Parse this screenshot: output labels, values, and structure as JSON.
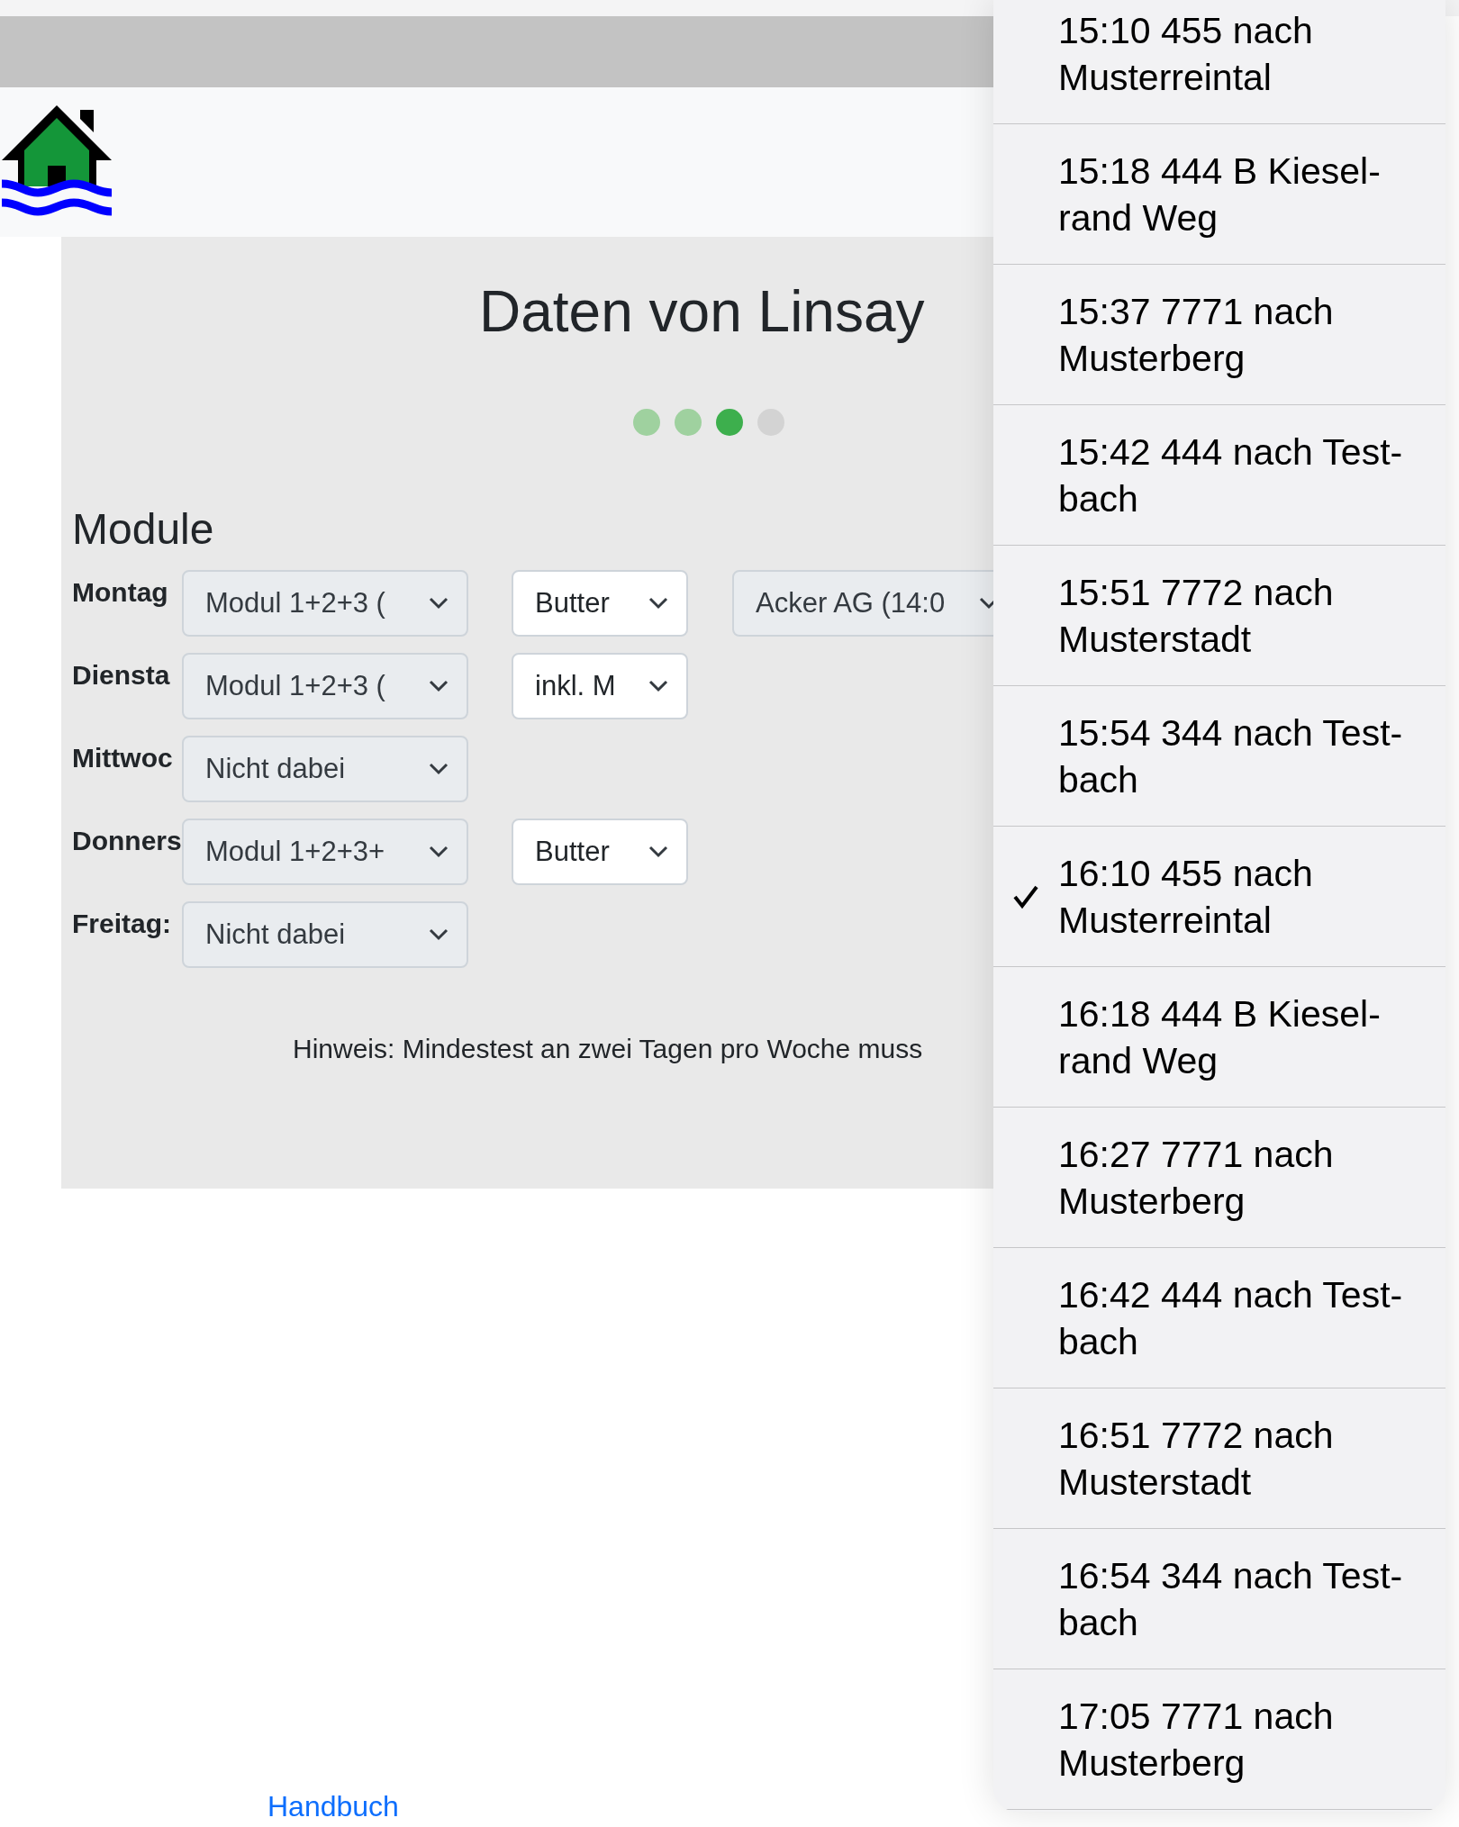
{
  "title": "Daten von Linsay",
  "steps": [
    {
      "done": true,
      "current": false
    },
    {
      "done": true,
      "current": false
    },
    {
      "current": true
    },
    {
      "done": false,
      "current": false
    }
  ],
  "section": "Module",
  "days": [
    {
      "label": "Montag",
      "selects": [
        {
          "value": "Modul 1+2+3 (",
          "disabled": true
        },
        {
          "value": "Butter",
          "disabled": false
        },
        {
          "value": "Acker AG (14:0",
          "disabled": true
        }
      ]
    },
    {
      "label": "Diensta",
      "selects": [
        {
          "value": "Modul 1+2+3 (",
          "disabled": true
        },
        {
          "value": "inkl. M",
          "disabled": false
        }
      ]
    },
    {
      "label": "Mittwoc",
      "selects": [
        {
          "value": "Nicht dabei",
          "disabled": true
        }
      ]
    },
    {
      "label": "Donners",
      "selects": [
        {
          "value": "Modul 1+2+3+",
          "disabled": true
        },
        {
          "value": "Butter",
          "disabled": false
        }
      ]
    },
    {
      "label": "Freitag:",
      "selects": [
        {
          "value": "Nicht dabei",
          "disabled": true
        }
      ]
    }
  ],
  "hint": "Hinweis: Mindestest an zwei Tagen pro Woche muss",
  "footer_link": "Handbuch",
  "dropdown": [
    {
      "text": "15:10 455 nach\nMusterreintal",
      "selected": false
    },
    {
      "text": "15:18 444 B Kiesel-\nrand Weg",
      "selected": false
    },
    {
      "text": "15:37 7771 nach\nMusterberg",
      "selected": false
    },
    {
      "text": "15:42 444 nach Test-\nbach",
      "selected": false
    },
    {
      "text": "15:51 7772 nach\nMusterstadt",
      "selected": false
    },
    {
      "text": "15:54 344 nach Test-\nbach",
      "selected": false
    },
    {
      "text": "16:10 455 nach\nMusterreintal",
      "selected": true
    },
    {
      "text": "16:18 444 B Kiesel-\nrand Weg",
      "selected": false
    },
    {
      "text": "16:27 7771 nach\nMusterberg",
      "selected": false
    },
    {
      "text": "16:42 444 nach Test-\nbach",
      "selected": false
    },
    {
      "text": "16:51 7772 nach\nMusterstadt",
      "selected": false
    },
    {
      "text": "16:54 344 nach Test-\nbach",
      "selected": false
    },
    {
      "text": "17:05 7771 nach\nMusterberg",
      "selected": false
    }
  ]
}
